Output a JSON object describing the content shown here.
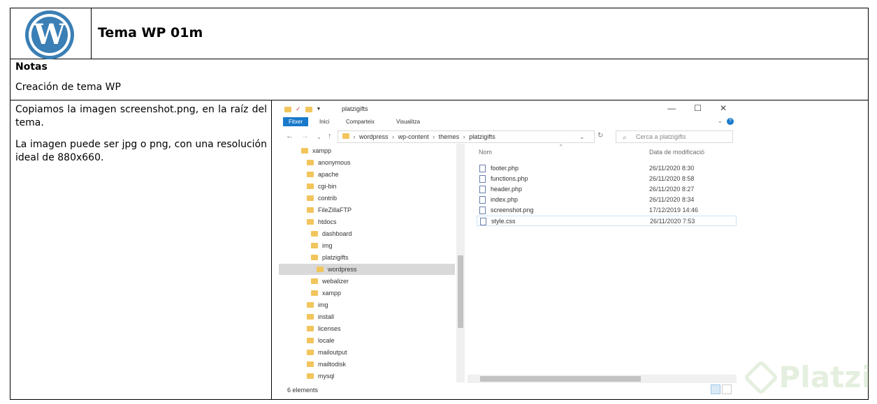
{
  "document": {
    "title": "Tema WP 01m",
    "notes_label": "Notas",
    "notes_text": "Creación de tema WP",
    "paragraphs": [
      "Copiamos la imagen screenshot.png, en la raíz del tema.",
      "La imagen puede ser jpg o png, con una resolución ideal de  880x660."
    ]
  },
  "explorer": {
    "window_title": "platzigifts",
    "window_buttons": [
      "—",
      "☐",
      "✕"
    ],
    "ribbon_tabs": [
      "Fitxer",
      "Inici",
      "Comparteix",
      "Visualitza"
    ],
    "address_parts": [
      "wordpress",
      "wp-content",
      "themes",
      "platzigifts"
    ],
    "search_placeholder": "Cerca a platzigifts",
    "tree": [
      {
        "label": "xampp"
      },
      {
        "label": "anonymous"
      },
      {
        "label": "apache"
      },
      {
        "label": "cgi-bin"
      },
      {
        "label": "contrib"
      },
      {
        "label": "FileZillaFTP"
      },
      {
        "label": "htdocs"
      },
      {
        "label": "dashboard"
      },
      {
        "label": "img"
      },
      {
        "label": "platzigifts"
      },
      {
        "label": "wordpress",
        "selected": true
      },
      {
        "label": "webalizer"
      },
      {
        "label": "xampp"
      },
      {
        "label": "img"
      },
      {
        "label": "install"
      },
      {
        "label": "licenses"
      },
      {
        "label": "locale"
      },
      {
        "label": "mailoutput"
      },
      {
        "label": "mailtodisk"
      },
      {
        "label": "mysql"
      }
    ],
    "columns": {
      "name": "Nom",
      "date": "Data de modificació"
    },
    "files": [
      {
        "name": "footer.php",
        "date": "26/11/2020 8:30"
      },
      {
        "name": "functions.php",
        "date": "26/11/2020 8:58"
      },
      {
        "name": "header.php",
        "date": "26/11/2020 8:27"
      },
      {
        "name": "index.php",
        "date": "26/11/2020 8:34"
      },
      {
        "name": "screenshot.png",
        "date": "17/12/2019 14:46"
      },
      {
        "name": "style.css",
        "date": "26/11/2020 7:53",
        "selected": true
      }
    ],
    "status_text": "6 elements"
  },
  "watermark": {
    "text": "Platzi",
    "color": "#8db870"
  },
  "colors": {
    "accent": "#1979ca",
    "folder": "#f2c55c",
    "wp_logo": "#3a7fb5"
  }
}
